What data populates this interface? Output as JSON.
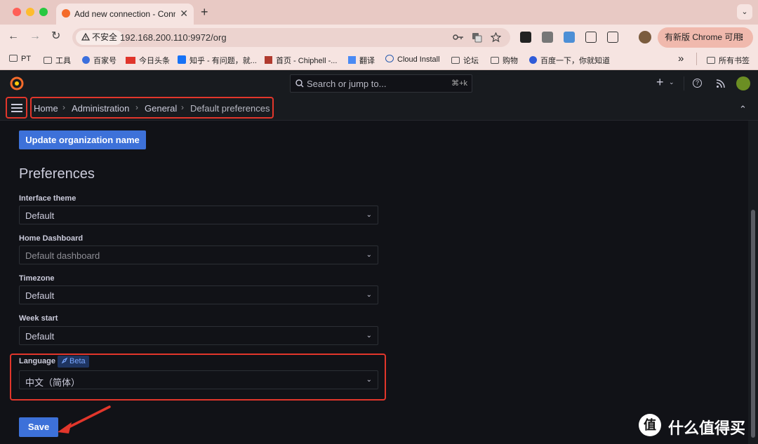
{
  "browser": {
    "tab_title": "Add new connection - Connections",
    "new_tab_glyph": "+",
    "tab_close_glyph": "✕",
    "tab_menu_glyph": "⌄",
    "insecure_label": "不安全",
    "url": "192.168.200.110:9972/org",
    "update_label": "有新版 Chrome 可用",
    "more_glyph": "⋮",
    "back_glyph": "←",
    "forward_glyph": "→",
    "reload_glyph": "↻"
  },
  "bookmarks": {
    "items": [
      "PT",
      "工具",
      "百家号",
      "今日头条",
      "知乎 - 有问题，就...",
      "首页 - Chiphell -...",
      "翻译",
      "Cloud Install",
      "论坛",
      "购物",
      "百度一下，你就知道"
    ],
    "overflow_glyph": "»",
    "all_bookmarks": "所有书签"
  },
  "grafana": {
    "search_placeholder": "Search or jump to...",
    "search_shortcut": "⌘+k",
    "plus_glyph": "+",
    "help_glyph": "?",
    "breadcrumb": [
      "Home",
      "Administration",
      "General",
      "Default preferences"
    ],
    "breadcrumb_sep": "›",
    "collapse_glyph": "⌃",
    "update_org_button": "Update organization name",
    "section_title": "Preferences",
    "fields": {
      "interface_theme": {
        "label": "Interface theme",
        "value": "Default"
      },
      "home_dashboard": {
        "label": "Home Dashboard",
        "value": "Default dashboard"
      },
      "timezone": {
        "label": "Timezone",
        "value": "Default"
      },
      "week_start": {
        "label": "Week start",
        "value": "Default"
      },
      "language": {
        "label": "Language",
        "badge": "Beta",
        "value": "中文（简体）"
      }
    },
    "chevron_glyph": "⌄",
    "save_button": "Save"
  },
  "watermark": {
    "text": "什么值得买",
    "logo_char": "值"
  },
  "colors": {
    "annotation_red": "#e2362b",
    "primary_blue": "#3d71d9",
    "grafana_orange": "#f46b2a"
  }
}
